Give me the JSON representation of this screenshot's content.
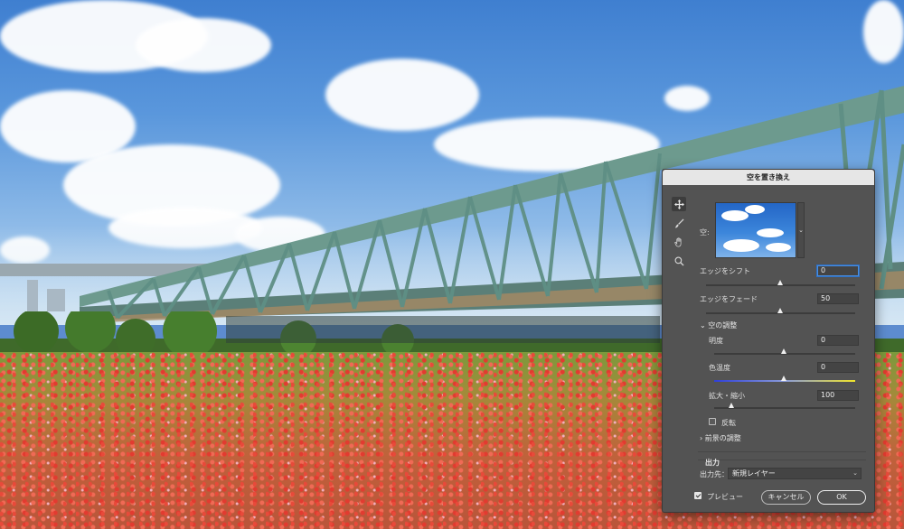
{
  "dialog": {
    "title": "空を置き換え",
    "sky_label": "空:",
    "edge_shift": {
      "label": "エッジをシフト",
      "value": "0",
      "level": 0.5
    },
    "edge_fade": {
      "label": "エッジをフェード",
      "value": "50",
      "level": 0.5
    },
    "sky_adjust": {
      "header": "空の調整",
      "brightness": {
        "label": "明度",
        "value": "0",
        "level": 0.5
      },
      "temperature": {
        "label": "色温度",
        "value": "0",
        "level": 0.5
      },
      "scale": {
        "label": "拡大・縮小",
        "value": "100",
        "level": 0.05
      },
      "flip_label": "反転",
      "flip_checked": false
    },
    "foreground_adjust_header": "前景の調整",
    "output": {
      "header": "出力",
      "dest_label": "出力先：",
      "dest_value": "新規レイヤー"
    },
    "preview": {
      "label": "プレビュー",
      "checked": true
    },
    "cancel_label": "キャンセル",
    "ok_label": "OK"
  },
  "tools": [
    "move-icon",
    "brush-icon",
    "hand-icon",
    "zoom-icon"
  ],
  "colors": {
    "accent": "#2d6fc4",
    "dialog_bg": "#535353",
    "titlebar_bg": "#e6e6e6"
  }
}
